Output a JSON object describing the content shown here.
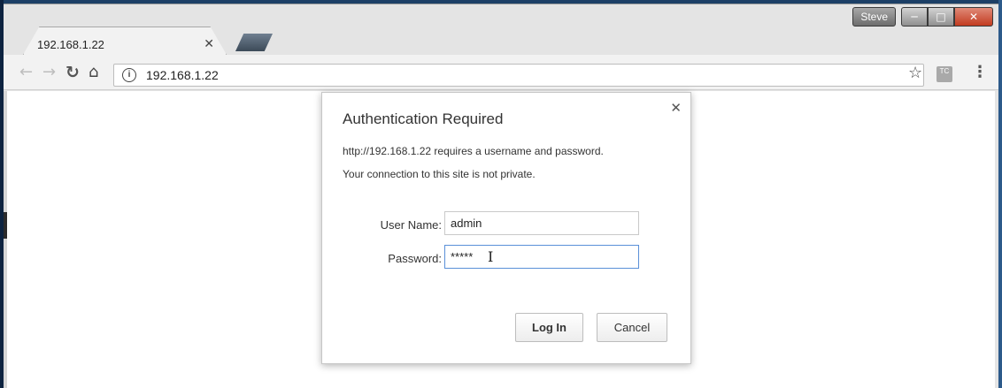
{
  "window": {
    "profile_name": "Steve",
    "controls": {
      "minimize_icon": "minimize-icon",
      "maximize_icon": "maximize-icon",
      "close_icon": "close-icon"
    }
  },
  "tabs": [
    {
      "title": "192.168.1.22",
      "close_icon": "close-icon",
      "active": true
    }
  ],
  "toolbar": {
    "back_icon": "arrow-left-icon",
    "forward_icon": "arrow-right-icon",
    "reload_icon": "reload-icon",
    "home_icon": "home-icon",
    "address_value": "192.168.1.22",
    "info_icon": "info-icon",
    "bookmark_icon": "star-icon",
    "extension_badge": "TC",
    "menu_icon": "kebab-menu-icon"
  },
  "dialog": {
    "title": "Authentication Required",
    "message_line1": "http://192.168.1.22  requires a username and password.",
    "message_line2": "Your connection to this site is not private.",
    "username_label": "User Name:",
    "username_value": "admin",
    "password_label": "Password:",
    "password_value": "*****",
    "login_button": "Log In",
    "cancel_button": "Cancel"
  }
}
